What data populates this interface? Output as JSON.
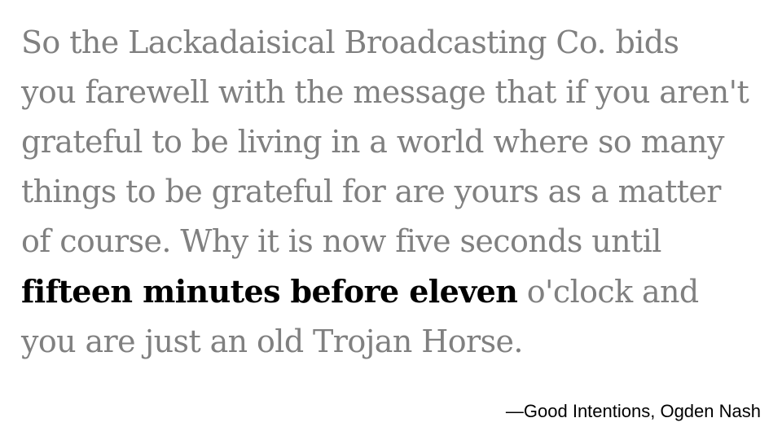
{
  "quote": {
    "lines": [
      "So the Lackadaisical Broadcasting Co. bids",
      "you farewell with the message that if you aren't",
      "grateful to be living in a world where so many",
      "things to be grateful for are yours as a matter",
      "of course. Why it is now five seconds until"
    ],
    "emphasis": "fifteen minutes before eleven",
    "line6_rest": " o'clock and",
    "line7": "you are just an old Trojan Horse."
  },
  "attribution": "—Good Intentions, Ogden Nash",
  "colors": {
    "body_text": "#808080",
    "emphasis_text": "#000000",
    "background": "#ffffff"
  }
}
